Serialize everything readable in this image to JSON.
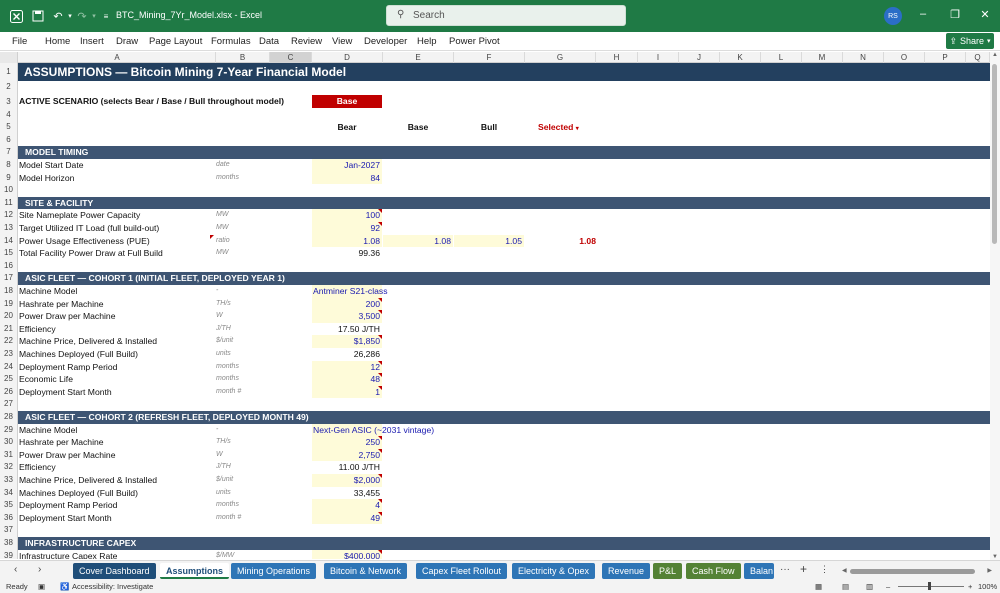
{
  "window": {
    "doc_title": "BTC_Mining_7Yr_Model.xlsx  -  Excel",
    "search_placeholder": "Search",
    "avatar_initials": "RS"
  },
  "menu": [
    "File",
    "Home",
    "Insert",
    "Draw",
    "Page Layout",
    "Formulas",
    "Data",
    "Review",
    "View",
    "Developer",
    "Help",
    "Power Pivot"
  ],
  "share_label": "Share",
  "columns": [
    "A",
    "B",
    "C",
    "D",
    "E",
    "F",
    "G",
    "H",
    "I",
    "J",
    "K",
    "L",
    "M",
    "N",
    "O",
    "P",
    "Q"
  ],
  "active_column": "C",
  "sheet": {
    "title": "ASSUMPTIONS  —  Bitcoin Mining 7-Year Financial Model",
    "scenario_label": "ACTIVE SCENARIO (selects Bear / Base / Bull throughout model)",
    "scenario_value": "Base",
    "scenario_headers": [
      "Bear",
      "Base",
      "Bull",
      "Selected"
    ],
    "sections": {
      "model_timing": "MODEL TIMING",
      "site": "SITE & FACILITY",
      "cohort1": "ASIC FLEET — COHORT 1 (INITIAL FLEET, DEPLOYED YEAR 1)",
      "cohort2": "ASIC FLEET — COHORT 2 (REFRESH FLEET, DEPLOYED MONTH 49)",
      "infra": "INFRASTRUCTURE CAPEX"
    },
    "rows": {
      "r8": {
        "label": "Model Start Date",
        "unit": "date",
        "value": "Jan-2027"
      },
      "r9": {
        "label": "Model Horizon",
        "unit": "months",
        "value": "84"
      },
      "r12": {
        "label": "Site Nameplate Power Capacity",
        "unit": "MW",
        "value": "100"
      },
      "r13": {
        "label": "Target Utilized IT Load (full build-out)",
        "unit": "MW",
        "value": "92"
      },
      "r14": {
        "label": "Power Usage Effectiveness (PUE)",
        "unit": "ratio",
        "value": "1.08",
        "base": "1.08",
        "bull": "1.05",
        "selected": "1.08"
      },
      "r15": {
        "label": "Total Facility Power Draw at Full Build",
        "unit": "MW",
        "value": "99.36"
      },
      "r18": {
        "label": "Machine Model",
        "unit": "-",
        "value": "Antminer S21-class"
      },
      "r19": {
        "label": "Hashrate per Machine",
        "unit": "TH/s",
        "value": "200"
      },
      "r20": {
        "label": "Power Draw per Machine",
        "unit": "W",
        "value": "3,500"
      },
      "r21": {
        "label": "Efficiency",
        "unit": "J/TH",
        "value": "17.50 J/TH"
      },
      "r22": {
        "label": "Machine Price, Delivered & Installed",
        "unit": "$/unit",
        "value": "$1,850"
      },
      "r23": {
        "label": "Machines Deployed (Full Build)",
        "unit": "units",
        "value": "26,286"
      },
      "r24": {
        "label": "Deployment Ramp Period",
        "unit": "months",
        "value": "12"
      },
      "r25": {
        "label": "Economic Life",
        "unit": "months",
        "value": "48"
      },
      "r26": {
        "label": "Deployment Start Month",
        "unit": "month #",
        "value": "1"
      },
      "r29": {
        "label": "Machine Model",
        "unit": "-",
        "value": "Next-Gen ASIC (~2031 vintage)"
      },
      "r30": {
        "label": "Hashrate per Machine",
        "unit": "TH/s",
        "value": "250"
      },
      "r31": {
        "label": "Power Draw per Machine",
        "unit": "W",
        "value": "2,750"
      },
      "r32": {
        "label": "Efficiency",
        "unit": "J/TH",
        "value": "11.00 J/TH"
      },
      "r33": {
        "label": "Machine Price, Delivered & Installed",
        "unit": "$/unit",
        "value": "$2,000"
      },
      "r34": {
        "label": "Machines Deployed (Full Build)",
        "unit": "units",
        "value": "33,455"
      },
      "r35": {
        "label": "Deployment Ramp Period",
        "unit": "months",
        "value": "4"
      },
      "r36": {
        "label": "Deployment Start Month",
        "unit": "month #",
        "value": "49"
      },
      "r39": {
        "label": "Infrastructure Capex Rate",
        "unit": "$/MW",
        "value": "$400,000"
      }
    }
  },
  "tabs": [
    {
      "label": "Cover Dashboard",
      "color": "#1f4e79"
    },
    {
      "label": "Assumptions",
      "color": "#1f4e79",
      "active": true
    },
    {
      "label": "Mining Operations",
      "color": "#2e75b6"
    },
    {
      "label": "Bitcoin & Network",
      "color": "#2e75b6"
    },
    {
      "label": "Capex Fleet Rollout",
      "color": "#2e75b6"
    },
    {
      "label": "Electricity & Opex",
      "color": "#2e75b6"
    },
    {
      "label": "Revenue",
      "color": "#2e75b6"
    },
    {
      "label": "P&L",
      "color": "#548235"
    },
    {
      "label": "Cash Flow",
      "color": "#548235"
    },
    {
      "label": "Balan",
      "color": "#2e75b6"
    }
  ],
  "status": {
    "ready": "Ready",
    "accessibility": "Accessibility: Investigate",
    "zoom": "100%"
  }
}
